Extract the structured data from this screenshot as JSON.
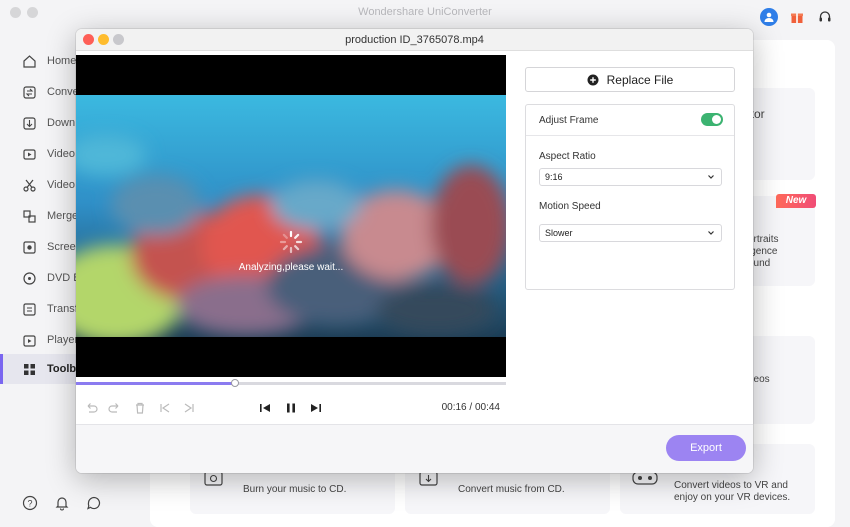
{
  "app": {
    "title": "Wondershare UniConverter",
    "sidebar": {
      "items": [
        {
          "label": "Home",
          "icon": "home-icon"
        },
        {
          "label": "Conve",
          "icon": "convert-icon"
        },
        {
          "label": "Down",
          "icon": "download-icon"
        },
        {
          "label": "Video",
          "icon": "video-edit-icon"
        },
        {
          "label": "Video",
          "icon": "scissors-icon"
        },
        {
          "label": "Merge",
          "icon": "merge-icon"
        },
        {
          "label": "Scree",
          "icon": "screen-record-icon"
        },
        {
          "label": "DVD B",
          "icon": "dvd-icon"
        },
        {
          "label": "Transf",
          "icon": "transfer-icon"
        },
        {
          "label": "Player",
          "icon": "player-icon"
        },
        {
          "label": "Toolbo",
          "icon": "toolbox-icon",
          "active": true
        }
      ]
    },
    "cards": {
      "editor_fragment": "itor",
      "portraits_lines": [
        "ortraits",
        "igence",
        "ound"
      ],
      "new_badge": "New",
      "videos_fragment": "deos",
      "burn_cd": "Burn your music to CD.",
      "convert_cd": "Convert music from CD.",
      "vr_line1": "Convert videos to VR and",
      "vr_line2": "enjoy on your VR devices."
    }
  },
  "modal": {
    "title": "production ID_3765078.mp4",
    "replace_button": "Replace File",
    "adjust_frame_label": "Adjust Frame",
    "adjust_frame_enabled": true,
    "aspect_ratio_label": "Aspect Ratio",
    "aspect_ratio_value": "9:16",
    "motion_speed_label": "Motion Speed",
    "motion_speed_value": "Slower",
    "analyzing_text": "Analyzing,please wait...",
    "time_current": "00:16",
    "time_separator": "/",
    "time_total": "00:44",
    "progress_fraction": 0.37,
    "export_button": "Export"
  },
  "colors": {
    "accent": "#8b7bf0",
    "export_bg": "#9c84f2",
    "toggle_on": "#3cb371",
    "close_dot": "#fe5f57",
    "min_dot": "#febc2e",
    "max_dot": "#c8c8cc"
  }
}
